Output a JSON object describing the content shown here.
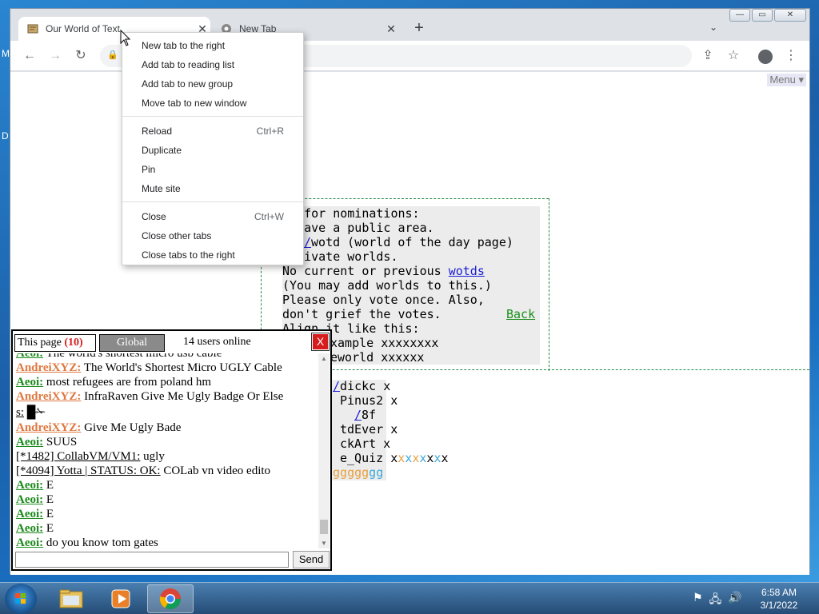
{
  "desktop": {
    "label_m": "M",
    "label_d": "D"
  },
  "browser": {
    "tabs": [
      {
        "title": "Our World of Text",
        "active": true
      },
      {
        "title": "New Tab",
        "active": false
      }
    ],
    "new_tab_glyph": "+",
    "tab_search_glyph": "⌄",
    "window_buttons": {
      "minimize": "—",
      "maximize": "▭",
      "close": "✕"
    },
    "toolbar_icons": {
      "back": "←",
      "forward": "→",
      "reload": "↻",
      "lock": "🔒",
      "share": "⇪",
      "star": "☆",
      "more": "⋮"
    }
  },
  "page": {
    "menu_label": "Menu",
    "text_lines": [
      "es for nominations:",
      "t have a public area.",
      "wotd (world of the day page)",
      " private worlds.",
      "No current or previous ",
      "(You may add worlds to this.)",
      "Please only vote once. Also,",
      "don't grief the votes.",
      "Align it like this:",
      "xample xxxxxxxx",
      "eworld xxxxxx"
    ],
    "link_wotds": "wotds",
    "link_back": "Back",
    "link_slash": "/",
    "lower_lines": [
      "dickc x",
      "Pinus2 x",
      "8f",
      "tdEver x",
      "ckArt x",
      "e_Quiz x"
    ],
    "lower_slash_1": "/",
    "lower_slash_2": "/",
    "colored_x": [
      "x",
      "x",
      "x",
      "x",
      "x",
      "x",
      "x"
    ],
    "colored_g": [
      "g",
      "g",
      "g",
      "g",
      "g",
      "g",
      "g"
    ]
  },
  "context_menu": {
    "items": [
      {
        "label": "New tab to the right",
        "shortcut": ""
      },
      {
        "label": "Add tab to reading list",
        "shortcut": ""
      },
      {
        "label": "Add tab to new group",
        "shortcut": ""
      },
      {
        "label": "Move tab to new window",
        "shortcut": ""
      },
      {
        "label": "Reload",
        "shortcut": "Ctrl+R"
      },
      {
        "label": "Duplicate",
        "shortcut": ""
      },
      {
        "label": "Pin",
        "shortcut": ""
      },
      {
        "label": "Mute site",
        "shortcut": ""
      },
      {
        "label": "Close",
        "shortcut": "Ctrl+W"
      },
      {
        "label": "Close other tabs",
        "shortcut": ""
      },
      {
        "label": "Close tabs to the right",
        "shortcut": ""
      }
    ]
  },
  "chat": {
    "tab_this_page": "This page",
    "tab_this_page_count": "(10)",
    "tab_global": "Global",
    "users_online": "14 users online",
    "close_label": "X",
    "send_label": "Send",
    "input_value": "",
    "partial_top": "The world's shortest micro usb cable",
    "messages": [
      {
        "nick": "AndreiXYZ:",
        "color": "orange",
        "text": " The World's Shortest Micro UGLY Cable"
      },
      {
        "nick": "Aeoi:",
        "color": "green",
        "text": " most refugees are from poland hm"
      },
      {
        "nick": "AndreiXYZ:",
        "color": "orange",
        "text": " InfraRaven Give Me Ugly Badge Or Else"
      },
      {
        "nick": "s:",
        "color": "green",
        "text": " █✁"
      },
      {
        "nick": "AndreiXYZ:",
        "color": "orange",
        "text": " Give Me Ugly Bade"
      },
      {
        "nick": "Aeoi:",
        "color": "green",
        "text": " SUUS"
      },
      {
        "nick": "[*1482] CollabVM/VM1:",
        "color": "plain",
        "text": " ugly"
      },
      {
        "nick": "[*4094] Yotta | STATUS: OK:",
        "color": "plain",
        "text": " COLab vn video edito"
      },
      {
        "nick": "Aeoi:",
        "color": "green",
        "text": " E"
      },
      {
        "nick": "Aeoi:",
        "color": "green",
        "text": " E"
      },
      {
        "nick": "Aeoi:",
        "color": "green",
        "text": " E"
      },
      {
        "nick": "Aeoi:",
        "color": "green",
        "text": " E"
      },
      {
        "nick": "Aeoi:",
        "color": "green",
        "text": " do you know tom gates"
      }
    ]
  },
  "taskbar": {
    "time": "6:58 AM",
    "date": "3/1/2022"
  },
  "colors": {
    "nick_green": "#1b8a1b",
    "nick_orange": "#e07840",
    "link_blue": "#1b1bd6",
    "close_red": "#d61c1c"
  }
}
